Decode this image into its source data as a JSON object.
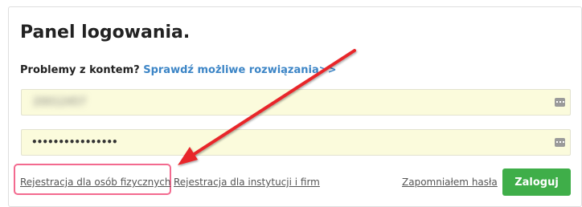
{
  "panel": {
    "title": "Panel logowania."
  },
  "help": {
    "question": "Problemy z kontem?",
    "link": "Sprawdź możliwe rozwiązania>>"
  },
  "form": {
    "login_value": "20012457",
    "password_value": "••••••••••••••••"
  },
  "footer": {
    "register_individual": "Rejestracja dla osób fizycznych",
    "register_institution": "Rejestracja dla instytucji i firm",
    "forgot_password": "Zapomniałem hasła",
    "login_button": "Zaloguj"
  },
  "colors": {
    "accent_link": "#3c85c6",
    "button_green": "#3fae49",
    "field_bg": "#fbfbdc",
    "annotation_red": "#e8262b",
    "highlight_pink": "#f36a8f"
  },
  "icons": {
    "password_manager": "password-manager-icon",
    "annotation_arrow": "red-arrow-annotation"
  }
}
